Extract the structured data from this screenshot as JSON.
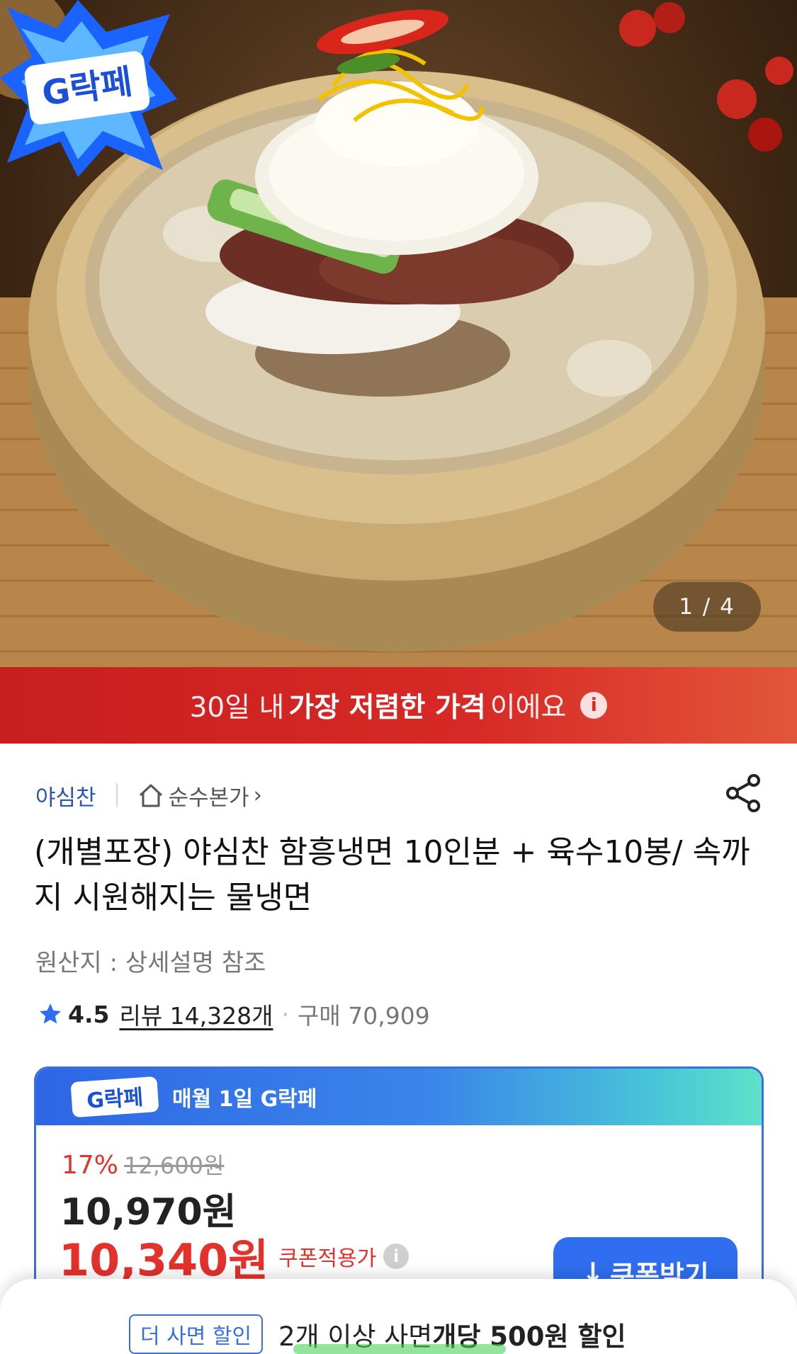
{
  "hero": {
    "image_counter": "1 / 4",
    "badge_label": "G락페"
  },
  "banner": {
    "text_prefix": "30일 내 ",
    "text_bold": "가장 저렴한 가격",
    "text_suffix": "이에요",
    "info_icon": "i"
  },
  "seller": {
    "name": "야심찬",
    "home_link": "순수본가",
    "home_chevron": "›"
  },
  "product": {
    "title": "(개별포장) 야심찬 함흥냉면 10인분 + 육수10봉/ 속까지 시원해지는 물냉면",
    "origin": "원산지 : 상세설명 참조",
    "rating": "4.5",
    "reviews": "리뷰 14,328개",
    "separator": "·",
    "purchases": "구매 70,909"
  },
  "deal": {
    "logo_text": "G락페",
    "title": "매월 1일 G락페",
    "discount_rate": "17%",
    "original_price": "12,600원",
    "price": "10,970원",
    "coupon_price": "10,340원",
    "coupon_label": "쿠폰적용가",
    "coupon_button": "쿠폰받기",
    "coupon_button_icon": "↓"
  },
  "bottom_sheet": {
    "tag": "더 사면 할인",
    "text_prefix": "2개 이상 사면 ",
    "text_bold": "개당 500원 할인"
  },
  "colors": {
    "accent_blue": "#2f6ef0",
    "sale_red": "#e3312b",
    "banner_red": "#d72a26"
  }
}
